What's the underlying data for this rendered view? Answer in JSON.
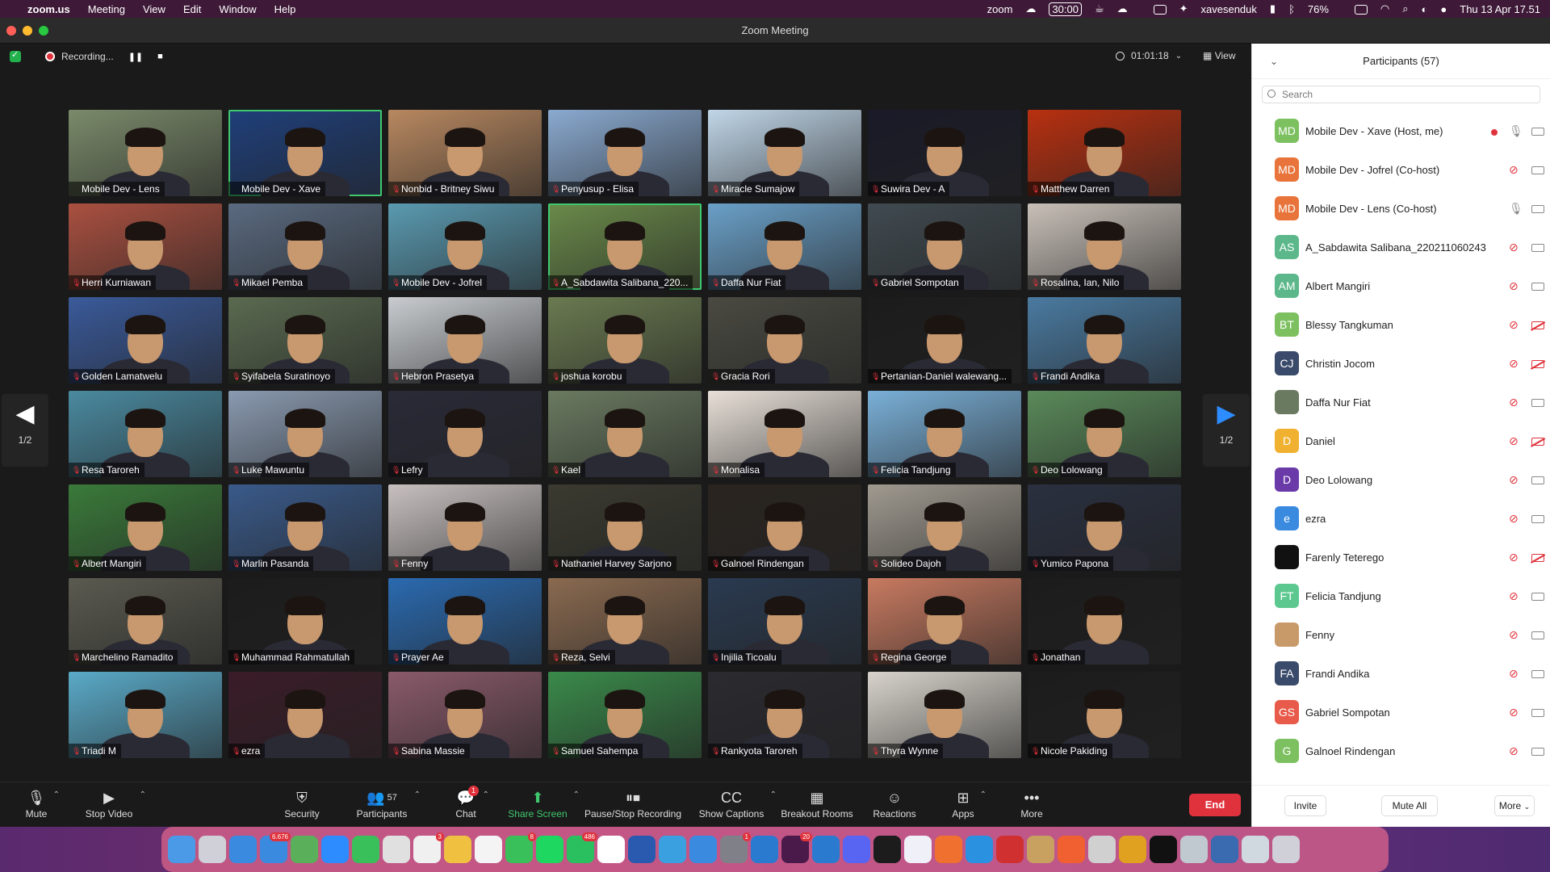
{
  "menubar": {
    "app": "zoom.us",
    "items": [
      "Meeting",
      "View",
      "Edit",
      "Window",
      "Help"
    ],
    "zoom_label": "zoom",
    "timer_badge": "30:00",
    "username": "xavesenduk",
    "battery": "76%",
    "datetime": "Thu 13 Apr  17.51"
  },
  "window": {
    "title": "Zoom Meeting"
  },
  "topstrip": {
    "recording": "Recording...",
    "pause": "❚❚",
    "stop": "■",
    "time": "01:01:18",
    "view": "View"
  },
  "pager": {
    "left": "1/2",
    "right": "1/2"
  },
  "tiles": [
    {
      "name": "Mobile Dev - Lens",
      "bg": "#7a8a6a",
      "muted": false,
      "active": false
    },
    {
      "name": "Mobile Dev - Xave",
      "bg": "#1f3f7a",
      "muted": false,
      "active": true
    },
    {
      "name": "Nonbid - Britney Siwu",
      "bg": "#b88860",
      "muted": true,
      "active": false
    },
    {
      "name": "Penyusup - Elisa",
      "bg": "#8aaad0",
      "muted": true,
      "active": false
    },
    {
      "name": "Miracle Sumajow",
      "bg": "#c0d6e8",
      "muted": true,
      "active": false
    },
    {
      "name": "Suwira Dev - A",
      "bg": "#1a1a28",
      "muted": true,
      "active": false
    },
    {
      "name": "Matthew Darren",
      "bg": "#b83010",
      "muted": true,
      "active": false
    },
    {
      "name": "Herri Kurniawan",
      "bg": "#aa5040",
      "muted": true,
      "active": false
    },
    {
      "name": "Mikael Pemba",
      "bg": "#5a6a80",
      "muted": true,
      "active": false
    },
    {
      "name": "Mobile Dev - Jofrel",
      "bg": "#5a9ab0",
      "muted": true,
      "active": false
    },
    {
      "name": "A_Sabdawita Salibana_220...",
      "bg": "#6a8a4a",
      "muted": true,
      "active": true
    },
    {
      "name": "Daffa Nur Fiat",
      "bg": "#6aa0c8",
      "muted": true,
      "active": false
    },
    {
      "name": "Gabriel Sompotan",
      "bg": "#404a50",
      "muted": true,
      "active": false
    },
    {
      "name": "Rosalina, Ian, Nilo",
      "bg": "#c8c0b8",
      "muted": true,
      "active": false
    },
    {
      "name": "Golden Lamatwelu",
      "bg": "#3a5a9a",
      "muted": true,
      "active": false
    },
    {
      "name": "Syifabela Suratinoyo",
      "bg": "#5a6a50",
      "muted": true,
      "active": false
    },
    {
      "name": "Hebron Prasetya",
      "bg": "#c8ccd0",
      "muted": true,
      "active": false
    },
    {
      "name": "joshua korobu",
      "bg": "#6a7a50",
      "muted": true,
      "active": false
    },
    {
      "name": "Gracia Rori",
      "bg": "#4a4a42",
      "muted": true,
      "active": false
    },
    {
      "name": "Pertanian-Daniel walewang...",
      "bg": "#1c1c1c",
      "muted": true,
      "active": false
    },
    {
      "name": "Frandi Andika",
      "bg": "#4a7aa0",
      "muted": true,
      "active": false
    },
    {
      "name": "Resa Taroreh",
      "bg": "#4a8aa0",
      "muted": true,
      "active": false
    },
    {
      "name": "Luke Mawuntu",
      "bg": "#8a9ab0",
      "muted": true,
      "active": false
    },
    {
      "name": "Lefry",
      "bg": "#2a2a38",
      "muted": true,
      "active": false
    },
    {
      "name": "Kael",
      "bg": "#6a7a60",
      "muted": true,
      "active": false
    },
    {
      "name": "Monalisa",
      "bg": "#e8e0d8",
      "muted": true,
      "active": false
    },
    {
      "name": "Felicia Tandjung",
      "bg": "#7ab0d8",
      "muted": true,
      "active": false
    },
    {
      "name": "Deo Lolowang",
      "bg": "#5a8a5a",
      "muted": true,
      "active": false
    },
    {
      "name": "Albert Mangiri",
      "bg": "#3a7a3a",
      "muted": true,
      "active": false
    },
    {
      "name": "Marlin Pasanda",
      "bg": "#3a5a8a",
      "muted": true,
      "active": false
    },
    {
      "name": "Fenny",
      "bg": "#c8c0c0",
      "muted": true,
      "active": false
    },
    {
      "name": "Nathaniel Harvey Sarjono",
      "bg": "#3a3a30",
      "muted": true,
      "active": false
    },
    {
      "name": "Galnoel Rindengan",
      "bg": "#2a2420",
      "muted": true,
      "active": false
    },
    {
      "name": "Solideo Dajoh",
      "bg": "#a09a90",
      "muted": true,
      "active": false
    },
    {
      "name": "Yumico Papona",
      "bg": "#2a3040",
      "muted": true,
      "active": false
    },
    {
      "name": "Marchelino Ramadito",
      "bg": "#5a5a50",
      "muted": true,
      "active": false
    },
    {
      "name": "Muhammad Rahmatullah",
      "bg": "#1c1c1c",
      "muted": true,
      "active": false
    },
    {
      "name": "Prayer Ae",
      "bg": "#2a6ab0",
      "muted": true,
      "active": false
    },
    {
      "name": "Reza, Selvi",
      "bg": "#8a6a50",
      "muted": true,
      "active": false
    },
    {
      "name": "Injilia Ticoalu",
      "bg": "#2a3a50",
      "muted": true,
      "active": false
    },
    {
      "name": "Regina George",
      "bg": "#c87a60",
      "muted": true,
      "active": false
    },
    {
      "name": "Jonathan",
      "bg": "#1c1c1c",
      "muted": true,
      "active": false
    },
    {
      "name": "Triadi M",
      "bg": "#5aaac8",
      "muted": true,
      "active": false
    },
    {
      "name": "ezra",
      "bg": "#3a1c28",
      "muted": true,
      "active": false
    },
    {
      "name": "Sabina Massie",
      "bg": "#8a5a6a",
      "muted": true,
      "active": false
    },
    {
      "name": "Samuel Sahempa",
      "bg": "#3a8a4a",
      "muted": true,
      "active": false
    },
    {
      "name": "Rankyota Taroreh",
      "bg": "#2a2a30",
      "muted": true,
      "active": false
    },
    {
      "name": "Thyra Wynne",
      "bg": "#d8d4cc",
      "muted": true,
      "active": false
    },
    {
      "name": "Nicole Pakiding",
      "bg": "#1c1c1c",
      "muted": true,
      "active": false
    }
  ],
  "toolbar": {
    "mute": "Mute",
    "stop_video": "Stop Video",
    "security": "Security",
    "participants": "Participants",
    "participants_count": "57",
    "chat": "Chat",
    "chat_badge": "1",
    "share_screen": "Share Screen",
    "pause_stop_recording": "Pause/Stop Recording",
    "show_captions": "Show Captions",
    "breakout_rooms": "Breakout Rooms",
    "reactions": "Reactions",
    "apps": "Apps",
    "more": "More",
    "end": "End"
  },
  "panel": {
    "title": "Participants (57)",
    "search_placeholder": "Search",
    "participants": [
      {
        "initials": "MD",
        "color": "#7cc060",
        "name": "Mobile Dev - Xave (Host, me)",
        "muted": false,
        "cam_off": false,
        "rec": true
      },
      {
        "initials": "MD",
        "color": "#e8743b",
        "name": "Mobile Dev - Jofrel (Co-host)",
        "muted": true,
        "cam_off": false,
        "rec": false
      },
      {
        "initials": "MD",
        "color": "#e8743b",
        "name": "Mobile Dev - Lens (Co-host)",
        "muted": false,
        "cam_off": false,
        "rec": false
      },
      {
        "initials": "AS",
        "color": "#5cb88a",
        "name": "A_Sabdawita Salibana_220211060243",
        "muted": true,
        "cam_off": false,
        "rec": false
      },
      {
        "initials": "AM",
        "color": "#5cb88a",
        "name": "Albert Mangiri",
        "muted": true,
        "cam_off": false,
        "rec": false
      },
      {
        "initials": "BT",
        "color": "#7cc060",
        "name": "Blessy Tangkuman",
        "muted": true,
        "cam_off": true,
        "rec": false
      },
      {
        "initials": "CJ",
        "color": "#3a4a6a",
        "name": "Christin Jocom",
        "muted": true,
        "cam_off": true,
        "rec": false
      },
      {
        "initials": "",
        "color": "#6a7a60",
        "name": "Daffa Nur Fiat",
        "muted": true,
        "cam_off": false,
        "rec": false
      },
      {
        "initials": "D",
        "color": "#f0b030",
        "name": "Daniel",
        "muted": true,
        "cam_off": true,
        "rec": false
      },
      {
        "initials": "D",
        "color": "#6a3aa8",
        "name": "Deo Lolowang",
        "muted": true,
        "cam_off": false,
        "rec": false
      },
      {
        "initials": "e",
        "color": "#3a8ae0",
        "name": "ezra",
        "muted": true,
        "cam_off": false,
        "rec": false
      },
      {
        "initials": "",
        "color": "#111111",
        "name": "Farenly Teterego",
        "muted": true,
        "cam_off": true,
        "rec": false
      },
      {
        "initials": "FT",
        "color": "#5cc890",
        "name": "Felicia Tandjung",
        "muted": true,
        "cam_off": false,
        "rec": false
      },
      {
        "initials": "",
        "color": "#c89a6a",
        "name": "Fenny",
        "muted": true,
        "cam_off": false,
        "rec": false
      },
      {
        "initials": "FA",
        "color": "#3a4a6a",
        "name": "Frandi Andika",
        "muted": true,
        "cam_off": false,
        "rec": false
      },
      {
        "initials": "GS",
        "color": "#e85a4a",
        "name": "Gabriel Sompotan",
        "muted": true,
        "cam_off": false,
        "rec": false
      },
      {
        "initials": "G",
        "color": "#7cc060",
        "name": "Galnoel Rindengan",
        "muted": true,
        "cam_off": false,
        "rec": false
      }
    ],
    "invite": "Invite",
    "mute_all": "Mute All",
    "more": "More"
  },
  "dock": {
    "icons": [
      {
        "name": "finder-icon",
        "color": "#4a9ae8",
        "badge": ""
      },
      {
        "name": "launchpad-icon",
        "color": "#d0d0d8",
        "badge": ""
      },
      {
        "name": "safari-icon",
        "color": "#3a8ae0",
        "badge": ""
      },
      {
        "name": "mail-icon",
        "color": "#3a8ae0",
        "badge": "6.676"
      },
      {
        "name": "maps-icon",
        "color": "#5ab05a",
        "badge": ""
      },
      {
        "name": "zoom-icon",
        "color": "#2d8cff",
        "badge": ""
      },
      {
        "name": "facetime-icon",
        "color": "#3ac05a",
        "badge": ""
      },
      {
        "name": "claquette-icon",
        "color": "#e0e0e0",
        "badge": ""
      },
      {
        "name": "reminders-icon",
        "color": "#f0f0f0",
        "badge": "3"
      },
      {
        "name": "photos-icon",
        "color": "#f0c040",
        "badge": ""
      },
      {
        "name": "calendar-icon",
        "color": "#f4f4f4",
        "badge": ""
      },
      {
        "name": "messages-icon",
        "color": "#3ac05a",
        "badge": "8"
      },
      {
        "name": "spotify-icon",
        "color": "#1ed760",
        "badge": ""
      },
      {
        "name": "whatsapp-icon",
        "color": "#2ac060",
        "badge": "486"
      },
      {
        "name": "notion-icon",
        "color": "#ffffff",
        "badge": ""
      },
      {
        "name": "word-icon",
        "color": "#2a5ab0",
        "badge": ""
      },
      {
        "name": "telegram-icon",
        "color": "#3aa0e0",
        "badge": ""
      },
      {
        "name": "appstore-icon",
        "color": "#3a8ae0",
        "badge": ""
      },
      {
        "name": "settings-icon",
        "color": "#808088",
        "badge": "1"
      },
      {
        "name": "trello-icon",
        "color": "#2a7ad0",
        "badge": ""
      },
      {
        "name": "slack-icon",
        "color": "#4a1a4a",
        "badge": "20"
      },
      {
        "name": "vscode-icon",
        "color": "#2a7ad0",
        "badge": ""
      },
      {
        "name": "discord-icon",
        "color": "#5865f2",
        "badge": ""
      },
      {
        "name": "figma-icon",
        "color": "#1c1c1c",
        "badge": ""
      },
      {
        "name": "vpn-icon",
        "color": "#f0f0f8",
        "badge": ""
      },
      {
        "name": "pen-icon",
        "color": "#f07030",
        "badge": ""
      },
      {
        "name": "docker-icon",
        "color": "#2a90e0",
        "badge": ""
      },
      {
        "name": "mendeley-icon",
        "color": "#d03030",
        "badge": ""
      },
      {
        "name": "archive-icon",
        "color": "#c8a060",
        "badge": ""
      },
      {
        "name": "postman-icon",
        "color": "#f06030",
        "badge": ""
      },
      {
        "name": "activity-icon",
        "color": "#d0d0d0",
        "badge": ""
      },
      {
        "name": "chrome-icon",
        "color": "#e0a020",
        "badge": ""
      },
      {
        "name": "terminal-icon",
        "color": "#111111",
        "badge": ""
      },
      {
        "name": "preview-icon",
        "color": "#c0c8d0",
        "badge": ""
      },
      {
        "name": "safari-tech-icon",
        "color": "#3a6ab0",
        "badge": ""
      },
      {
        "name": "downloads-icon",
        "color": "#d0d8e0",
        "badge": ""
      },
      {
        "name": "trash-icon",
        "color": "#d0d0d8",
        "badge": ""
      }
    ]
  },
  "colors": {
    "accent": "#2d8cff",
    "green": "#3fc86e",
    "red": "#e0323c"
  }
}
